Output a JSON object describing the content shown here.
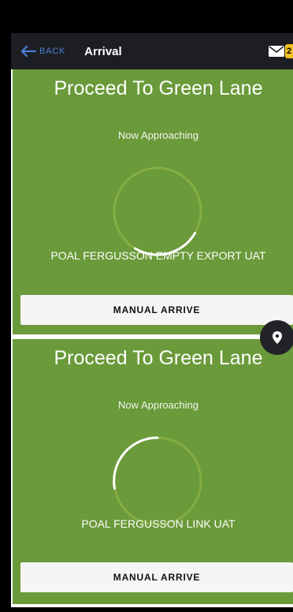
{
  "header": {
    "back_label": "BACK",
    "title": "Arrival",
    "mail_badge": "2"
  },
  "colors": {
    "card_green": "#6a9a3a",
    "ring_track": "#86ad43",
    "ring_progress": "#ffffff",
    "back_blue": "#4a7fd8",
    "badge_yellow": "#f2c11e",
    "header_dark": "#1d1e24"
  },
  "cards": [
    {
      "title": "Proceed To Green Lane",
      "status": "Now Approaching",
      "port": "POAL FERGUSSON EMPTY EXPORT UAT",
      "button": "MANUAL ARRIVE"
    },
    {
      "title": "Proceed To Green Lane",
      "status": "Now Approaching",
      "port": "POAL FERGUSSON LINK UAT",
      "button": "MANUAL ARRIVE"
    }
  ],
  "icons": {
    "back": "arrow-left-icon",
    "mail": "mail-icon",
    "fab": "map-pin-icon"
  }
}
